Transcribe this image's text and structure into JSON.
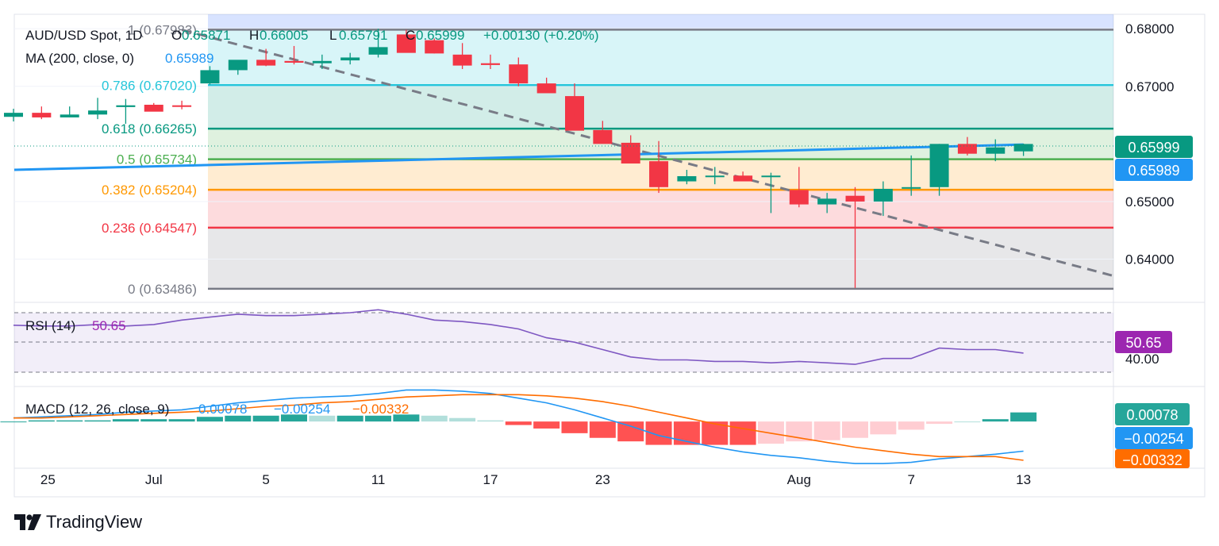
{
  "header": {
    "symbol": "AUD/USD Spot, 1D",
    "open_label": "O",
    "open": "0.65871",
    "high_label": "H",
    "high": "0.66005",
    "low_label": "L",
    "low": "0.65791",
    "close_label": "C",
    "close": "0.65999",
    "change": "+0.00130 (+0.20%)"
  },
  "ma_legend": {
    "label": "MA (200, close, 0)",
    "value": "0.65989"
  },
  "fib_levels": [
    {
      "ratio_label": "1",
      "value_label": "(0.67983)",
      "price": 0.67983,
      "color": "#787b86"
    },
    {
      "ratio_label": "0.786",
      "value_label": "(0.67020)",
      "price": 0.6702,
      "color": "#26c6da"
    },
    {
      "ratio_label": "0.618",
      "value_label": "(0.66265)",
      "price": 0.66265,
      "color": "#089981"
    },
    {
      "ratio_label": "0.5",
      "value_label": "(0.65734)",
      "price": 0.65734,
      "color": "#4caf50"
    },
    {
      "ratio_label": "0.382",
      "value_label": "(0.65204)",
      "price": 0.65204,
      "color": "#ff9800"
    },
    {
      "ratio_label": "0.236",
      "value_label": "(0.64547)",
      "price": 0.64547,
      "color": "#f23645"
    },
    {
      "ratio_label": "0",
      "value_label": "(0.63486)",
      "price": 0.63486,
      "color": "#787b86"
    }
  ],
  "price_axis": {
    "ticks": [
      "0.68000",
      "0.67000",
      "0.65000",
      "0.64000"
    ],
    "tick_values": [
      0.68,
      0.67,
      0.65,
      0.64
    ]
  },
  "price_badges": {
    "last": "0.65999",
    "ma": "0.65989"
  },
  "rsi": {
    "label": "RSI (14)",
    "value": "50.65",
    "axis_tick": "40.00",
    "badge": "50.65"
  },
  "macd": {
    "label": "MACD (12, 26, close, 9)",
    "macd_value": "0.00078",
    "signal_value": "−0.00254",
    "hist_value": "−0.00332",
    "badges": [
      "0.00078",
      "−0.00254",
      "−0.00332"
    ]
  },
  "time_axis": {
    "labels": [
      "25",
      "Jul",
      "5",
      "11",
      "17",
      "23",
      "Aug",
      "7",
      "13"
    ]
  },
  "brand": {
    "name": "TradingView"
  },
  "colors": {
    "up": "#089981",
    "down": "#f23645",
    "ma": "#2196f3",
    "rsi": "#9c27b0",
    "macd_line": "#2196f3",
    "signal_line": "#ff6d00"
  },
  "chart_data": {
    "type": "candlestick",
    "title": "AUD/USD Spot, 1D",
    "x": [
      "Jun 24",
      "Jun 25",
      "Jun 26",
      "Jun 27",
      "Jun 28",
      "Jul 1",
      "Jul 2",
      "Jul 3",
      "Jul 4",
      "Jul 5",
      "Jul 8",
      "Jul 9",
      "Jul 10",
      "Jul 11",
      "Jul 12",
      "Jul 15",
      "Jul 16",
      "Jul 17",
      "Jul 18",
      "Jul 19",
      "Jul 22",
      "Jul 23",
      "Jul 24",
      "Jul 25",
      "Jul 26",
      "Jul 29",
      "Jul 30",
      "Jul 31",
      "Aug 1",
      "Aug 2",
      "Aug 5",
      "Aug 6",
      "Aug 7",
      "Aug 8",
      "Aug 9",
      "Aug 12",
      "Aug 13"
    ],
    "open": [
      0.6647,
      0.6654,
      0.6646,
      0.6651,
      0.6664,
      0.6668,
      0.6667,
      0.6705,
      0.6728,
      0.6746,
      0.6744,
      0.674,
      0.6745,
      0.6755,
      0.679,
      0.678,
      0.6755,
      0.674,
      0.6738,
      0.6705,
      0.6683,
      0.6624,
      0.6602,
      0.657,
      0.6535,
      0.6545,
      0.6545,
      0.6545,
      0.652,
      0.6495,
      0.651,
      0.65,
      0.6525,
      0.6525,
      0.66,
      0.6583,
      0.65871
    ],
    "high": [
      0.6661,
      0.6665,
      0.6665,
      0.668,
      0.6678,
      0.6671,
      0.6675,
      0.6735,
      0.6745,
      0.6765,
      0.677,
      0.6755,
      0.6758,
      0.68,
      0.6798,
      0.6783,
      0.6775,
      0.6755,
      0.675,
      0.6715,
      0.6705,
      0.664,
      0.6615,
      0.6605,
      0.6555,
      0.656,
      0.6552,
      0.655,
      0.656,
      0.6515,
      0.6525,
      0.6535,
      0.658,
      0.66,
      0.6612,
      0.6608,
      0.66005
    ],
    "low": [
      0.6639,
      0.6643,
      0.6646,
      0.6643,
      0.6635,
      0.6657,
      0.666,
      0.6703,
      0.672,
      0.6735,
      0.6738,
      0.673,
      0.6738,
      0.675,
      0.6765,
      0.6757,
      0.673,
      0.673,
      0.67,
      0.669,
      0.6645,
      0.6615,
      0.6574,
      0.6515,
      0.653,
      0.653,
      0.654,
      0.648,
      0.649,
      0.648,
      0.635,
      0.6475,
      0.651,
      0.651,
      0.658,
      0.657,
      0.65791
    ],
    "close": [
      0.6654,
      0.6646,
      0.6651,
      0.6658,
      0.6667,
      0.6656,
      0.6665,
      0.6728,
      0.6746,
      0.6736,
      0.6741,
      0.6744,
      0.675,
      0.6768,
      0.6758,
      0.6757,
      0.6736,
      0.6737,
      0.6705,
      0.6688,
      0.6623,
      0.66,
      0.6566,
      0.6525,
      0.6544,
      0.6545,
      0.6535,
      0.6545,
      0.6495,
      0.6505,
      0.65,
      0.6522,
      0.6525,
      0.66,
      0.6583,
      0.6594,
      0.65999
    ],
    "ma200": {
      "start": 0.6555,
      "end": 0.65989
    },
    "trendline": {
      "from": [
        "Jul 2",
        0.6798
      ],
      "to": [
        "Aug 22",
        0.6371
      ]
    },
    "rsi": [
      69.5,
      69,
      69,
      70,
      69,
      70,
      73,
      75,
      77,
      76,
      76,
      77,
      78,
      80,
      77,
      73,
      72,
      70,
      67,
      61,
      58,
      53,
      48,
      46,
      46,
      45,
      45,
      44,
      45,
      44,
      43,
      47,
      47,
      54,
      53,
      53,
      50.65
    ],
    "macd_line": [
      0.0003,
      0.0004,
      0.0005,
      0.0006,
      0.0008,
      0.0009,
      0.001,
      0.0013,
      0.0016,
      0.0018,
      0.002,
      0.0021,
      0.0022,
      0.0024,
      0.0027,
      0.0027,
      0.0026,
      0.0024,
      0.002,
      0.0016,
      0.001,
      0.0003,
      -0.0004,
      -0.0012,
      -0.0017,
      -0.0022,
      -0.0026,
      -0.0029,
      -0.0031,
      -0.0034,
      -0.0036,
      -0.0036,
      -0.0035,
      -0.0032,
      -0.003,
      -0.0028,
      -0.00254
    ],
    "signal_line": [
      0.0003,
      0.0003,
      0.0004,
      0.0005,
      0.0006,
      0.0007,
      0.0008,
      0.0009,
      0.0011,
      0.0013,
      0.0014,
      0.0016,
      0.0017,
      0.0019,
      0.0021,
      0.0022,
      0.0023,
      0.0023,
      0.0023,
      0.0022,
      0.002,
      0.0017,
      0.0013,
      0.0008,
      0.0003,
      -0.0002,
      -0.0006,
      -0.001,
      -0.0014,
      -0.0018,
      -0.0022,
      -0.0025,
      -0.0028,
      -0.003,
      -0.003,
      -0.003,
      -0.00332
    ],
    "histogram": [
      0.0,
      0.0001,
      0.0001,
      0.0001,
      0.0002,
      0.0002,
      0.0002,
      0.0004,
      0.0005,
      0.0005,
      0.0006,
      0.0005,
      0.0005,
      0.0005,
      0.0006,
      0.0005,
      0.0003,
      0.0001,
      -0.0003,
      -0.0006,
      -0.001,
      -0.0014,
      -0.0017,
      -0.002,
      -0.002,
      -0.002,
      -0.002,
      -0.0019,
      -0.0017,
      -0.0016,
      -0.0014,
      -0.0011,
      -0.0007,
      -0.0002,
      0.0,
      0.0002,
      0.00078
    ],
    "ylim_price": [
      0.6325,
      0.6825
    ],
    "ylim_rsi": [
      28,
      85
    ],
    "ylim_macd": [
      -0.004,
      0.003
    ],
    "grid": true
  }
}
